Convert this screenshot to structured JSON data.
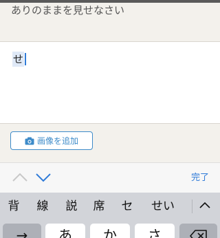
{
  "question": {
    "prompt_text": "ありのままを見せなさい"
  },
  "answer": {
    "input_text": "せ"
  },
  "add_image": {
    "label": "画像を追加",
    "icon": "camera-icon"
  },
  "accessory": {
    "prev_icon": "chevron-up-icon",
    "next_icon": "chevron-down-icon",
    "done_label": "完了"
  },
  "candidates": [
    "背",
    "線",
    "説",
    "席",
    "セ",
    "せい"
  ],
  "candidates_expand_icon": "chevron-up-icon",
  "keys": {
    "left": "→",
    "a": "あ",
    "ka": "か",
    "sa": "さ",
    "delete_icon": "delete-icon"
  },
  "colors": {
    "accent": "#2f7bd8",
    "button_border": "#3d8bc9",
    "keyboard_bg": "#d2d4d9"
  }
}
